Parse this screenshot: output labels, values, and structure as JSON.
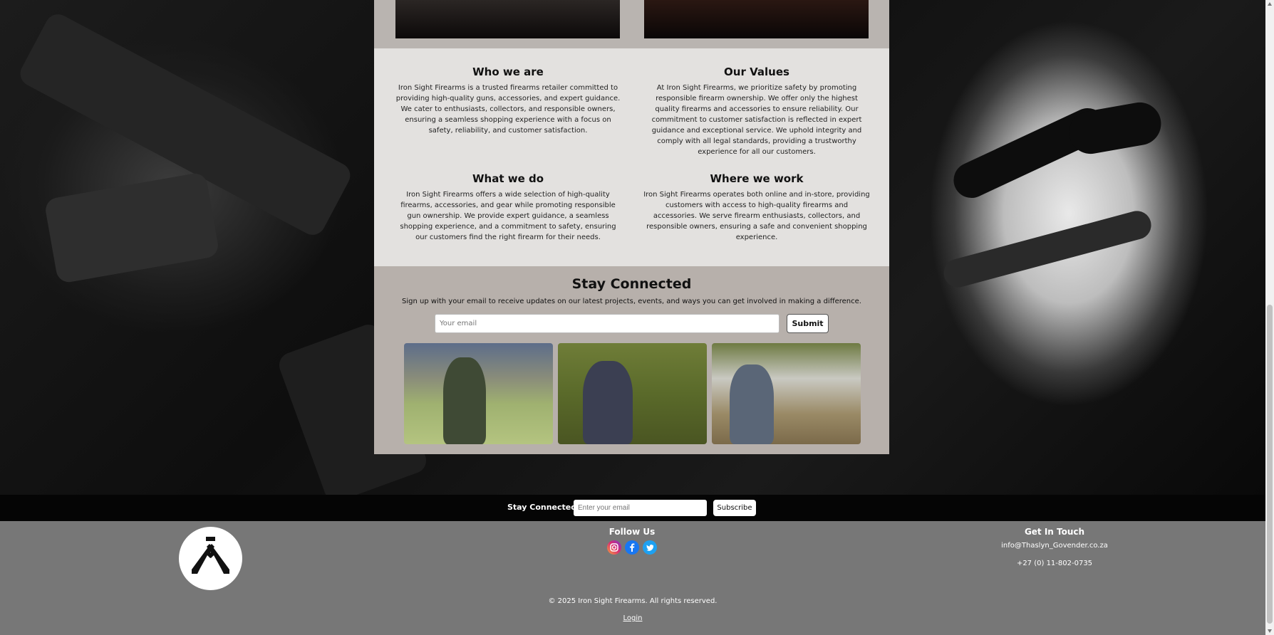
{
  "sections": [
    {
      "title": "Who we are",
      "text": "Iron Sight Firearms is a trusted firearms retailer committed to providing high-quality guns, accessories, and expert guidance. We cater to enthusiasts, collectors, and responsible owners, ensuring a seamless shopping experience with a focus on safety, reliability, and customer satisfaction."
    },
    {
      "title": "Our Values",
      "text": "At Iron Sight Firearms, we prioritize safety by promoting responsible firearm ownership. We offer only the highest quality firearms and accessories to ensure reliability. Our commitment to customer satisfaction is reflected in expert guidance and exceptional service. We uphold integrity and comply with all legal standards, providing a trustworthy experience for all our customers."
    },
    {
      "title": "What we do",
      "text": "Iron Sight Firearms offers a wide selection of high-quality firearms, accessories, and gear while promoting responsible gun ownership. We provide expert guidance, a seamless shopping experience, and a commitment to safety, ensuring our customers find the right firearm for their needs."
    },
    {
      "title": "Where we work",
      "text": "Iron Sight Firearms operates both online and in-store, providing customers with access to high-quality firearms and accessories. We serve firearm enthusiasts, collectors, and responsible owners, ensuring a safe and convenient shopping experience."
    }
  ],
  "stay_connected": {
    "title": "Stay Connected",
    "subtitle": "Sign up with your email to receive updates on our latest projects, events, and ways you can get involved in making a difference.",
    "placeholder": "Your email",
    "submit_label": "Submit"
  },
  "newsletter": {
    "label": "Stay Connected",
    "placeholder": "Enter your email",
    "button_label": "Subscribe"
  },
  "footer": {
    "follow_title": "Follow Us",
    "social_icons": [
      "instagram-icon",
      "facebook-icon",
      "twitter-icon"
    ],
    "contact_title": "Get In Touch",
    "email": "info@Thaslyn_Govender.co.za",
    "phone": "+27 (0) 11-802-0735",
    "copyright": "© 2025 Iron Sight Firearms. All rights reserved.",
    "login_label": "Login"
  },
  "colors": {
    "panel": "#e3e1df",
    "stay_section": "#b7b0ab",
    "footer": "#777777",
    "news_bar": "#050505",
    "instagram": "#d62976",
    "facebook": "#1877f2",
    "twitter": "#1da1f2"
  }
}
